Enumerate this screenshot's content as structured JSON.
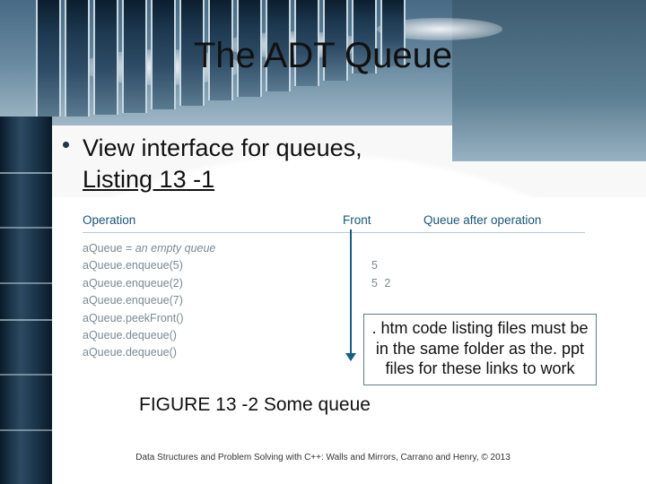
{
  "title": "The ADT Queue",
  "bullet": {
    "text": "View interface for queues,",
    "link_label": "Listing 13 -1"
  },
  "figure": {
    "head": {
      "col1": "Operation",
      "col2": "Front",
      "col3": "Queue after operation"
    },
    "rows": [
      {
        "op_pre": "aQueue = ",
        "op_ital": "an empty queue",
        "result": ""
      },
      {
        "op_pre": "aQueue.enqueue(5)",
        "op_ital": "",
        "result": "5"
      },
      {
        "op_pre": "aQueue.enqueue(2)",
        "op_ital": "",
        "result": "5 2"
      },
      {
        "op_pre": "aQueue.enqueue(7)",
        "op_ital": "",
        "result": ""
      },
      {
        "op_pre": "aQueue.peekFront()",
        "op_ital": "",
        "result": ""
      },
      {
        "op_pre": "aQueue.dequeue()",
        "op_ital": "",
        "result": ""
      },
      {
        "op_pre": "aQueue.dequeue()",
        "op_ital": "",
        "result": ""
      }
    ]
  },
  "caption": "FIGURE 13 -2 Some queue",
  "notebox": ". htm code listing  files must be in the same folder as the. ppt files for these links to work",
  "footer": "Data Structures and Problem Solving with C++: Walls and Mirrors, Carrano and Henry, ©  2013"
}
